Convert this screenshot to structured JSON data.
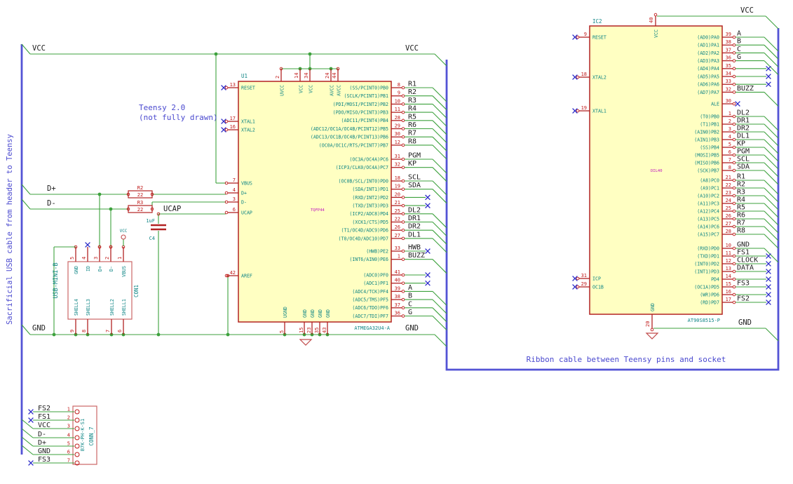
{
  "notes": {
    "usb_cable": "Sacrificial USB cable from header to Teensy",
    "teensy_line1": "Teensy 2.0",
    "teensy_line2": "(not fully drawn)",
    "ribbon": "Ribbon cable between Teensy pins and socket"
  },
  "wire_labels": {
    "vcc_top_left": "VCC",
    "vcc_top_right": "VCC",
    "gnd_bottom_left": "GND",
    "gnd_bottom_right": "GND",
    "dplus": "D+",
    "dminus": "D-",
    "ucap": "UCAP",
    "ic2_vcc": "VCC",
    "ic2_gnd": "GND"
  },
  "u1": {
    "ref": "U1",
    "value": "ATMEGA32U4-A",
    "footprint": "TQFP44",
    "top_pins": [
      {
        "num": "2",
        "name": "UVCC"
      },
      {
        "num": "14",
        "name": "VCC"
      },
      {
        "num": "34",
        "name": "VCC"
      },
      {
        "num": "24",
        "name": "AVCC"
      },
      {
        "num": "44",
        "name": "AVCC"
      }
    ],
    "bottom_pins": [
      {
        "num": "5",
        "name": "UGND"
      },
      {
        "num": "15",
        "name": "GND"
      },
      {
        "num": "23",
        "name": "GND"
      },
      {
        "num": "35",
        "name": "GND"
      },
      {
        "num": "43",
        "name": "GND"
      }
    ],
    "left_pins": [
      {
        "num": "13",
        "name": "RESET",
        "nc": true
      },
      {
        "num": "17",
        "name": "XTAL1",
        "nc": true
      },
      {
        "num": "16",
        "name": "XTAL2",
        "nc": true
      },
      {
        "num": "7",
        "name": "VBUS"
      },
      {
        "num": "4",
        "name": "D+"
      },
      {
        "num": "3",
        "name": "D-"
      },
      {
        "num": "6",
        "name": "UCAP"
      },
      {
        "num": "42",
        "name": "AREF"
      }
    ],
    "right_groups": [
      [
        {
          "num": "8",
          "name": "(SS/PCINT0)PB0",
          "net": "R1",
          "term": "bus"
        },
        {
          "num": "9",
          "name": "(SCLK/PCINT1)PB1",
          "net": "R2",
          "term": "bus"
        },
        {
          "num": "10",
          "name": "(PDI/MOSI/PCINT2)PB2",
          "net": "R3",
          "term": "bus"
        },
        {
          "num": "11",
          "name": "(PDO/MISO/PCINT3)PB3",
          "net": "R4",
          "term": "bus"
        },
        {
          "num": "28",
          "name": "(ADC11/PCINT4)PB4",
          "net": "R5",
          "term": "bus"
        },
        {
          "num": "29",
          "name": "(ADC12/OC1A/OC4B/PCINT12)PB5",
          "net": "R6",
          "term": "bus"
        },
        {
          "num": "30",
          "name": "(ADC13/OC1B/OC4B/PCINT13)PB6",
          "net": "R7",
          "term": "bus"
        },
        {
          "num": "12",
          "name": "(OC0A/OC1C/RTS/PCINT7)PB7",
          "net": "R8",
          "term": "bus"
        }
      ],
      [
        {
          "num": "31",
          "name": "(OC3A/OC4A)PC6",
          "net": "PGM",
          "term": "bus"
        },
        {
          "num": "32",
          "name": "(ICP3/CLK0/OC4A)PC7",
          "net": "KP",
          "term": "bus"
        }
      ],
      [
        {
          "num": "18",
          "name": "(OC0B/SCL/INT0)PD0",
          "net": "SCL",
          "term": "bus"
        },
        {
          "num": "19",
          "name": "(SDA/INT1)PD1",
          "net": "SDA",
          "term": "bus"
        },
        {
          "num": "20",
          "name": "(RXD/INT2)PD2",
          "term": "nc"
        },
        {
          "num": "21",
          "name": "(TXD/INT3)PD3",
          "term": "nc"
        },
        {
          "num": "25",
          "name": "(ICP2/ADC8)PD4",
          "net": "DL2",
          "term": "bus"
        },
        {
          "num": "22",
          "name": "(XCK1/CTS)PD5",
          "net": "DR1",
          "term": "bus"
        },
        {
          "num": "26",
          "name": "(T1/OC4D/ADC9)PD6",
          "net": "DR2",
          "term": "bus"
        },
        {
          "num": "27",
          "name": "(T0/OC4D/ADC10)PD7",
          "net": "DL1",
          "term": "bus"
        }
      ],
      [
        {
          "num": "33",
          "name": "(HWB)PE2",
          "net": "HWB",
          "term": "label_nc"
        },
        {
          "num": "1",
          "name": "(INT6/AIN0)PE6",
          "net": "BUZZ",
          "term": "bus"
        }
      ],
      [
        {
          "num": "41",
          "name": "(ADC0)PF0",
          "term": "nc"
        },
        {
          "num": "40",
          "name": "(ADC1)PF1",
          "term": "nc"
        },
        {
          "num": "39",
          "name": "(ADC4/TCK)PF4",
          "net": "A",
          "term": "bus"
        },
        {
          "num": "38",
          "name": "(ADC5/TMS)PF5",
          "net": "B",
          "term": "bus"
        },
        {
          "num": "37",
          "name": "(ADC6/TDO)PF6",
          "net": "C",
          "term": "bus"
        },
        {
          "num": "36",
          "name": "(ADC7/TDI)PF7",
          "net": "G",
          "term": "bus"
        }
      ]
    ]
  },
  "ic2": {
    "ref": "IC2",
    "value": "AT90S8515-P",
    "footprint": "DIL40",
    "top_pins": [
      {
        "num": "40",
        "name": "VCC"
      }
    ],
    "bottom_pins": [
      {
        "num": "20",
        "name": "GND"
      }
    ],
    "left_pins": [
      {
        "num": "9",
        "name": "RESET",
        "nc": true
      },
      {
        "num": "18",
        "name": "XTAL2",
        "nc": true
      },
      {
        "num": "19",
        "name": "XTAL1",
        "nc": true
      },
      {
        "num": "31",
        "name": "ICP",
        "nc": true
      },
      {
        "num": "29",
        "name": "OC1B",
        "nc": true
      }
    ],
    "right_groups": [
      [
        {
          "num": "39",
          "name": "(AD0)PA0",
          "net": "A",
          "term": "bus"
        },
        {
          "num": "38",
          "name": "(AD1)PA1",
          "net": "B",
          "term": "bus"
        },
        {
          "num": "37",
          "name": "(AD2)PA2",
          "net": "C",
          "term": "bus"
        },
        {
          "num": "36",
          "name": "(AD3)PA3",
          "net": "G",
          "term": "bus"
        },
        {
          "num": "35",
          "name": "(AD4)PA4",
          "term": "nc"
        },
        {
          "num": "34",
          "name": "(AD5)PA5",
          "term": "nc"
        },
        {
          "num": "33",
          "name": "(AD6)PA6",
          "term": "nc"
        },
        {
          "num": "32",
          "name": "(AD7)PA7",
          "net": "BUZZ",
          "term": "bus"
        }
      ],
      [
        {
          "num": "30",
          "name": "ALE",
          "term": "nc_short"
        }
      ],
      [
        {
          "num": "1",
          "name": "(T0)PB0",
          "net": "DL2",
          "term": "bus"
        },
        {
          "num": "2",
          "name": "(T1)PB1",
          "net": "DR1",
          "term": "bus"
        },
        {
          "num": "3",
          "name": "(AIN0)PB2",
          "net": "DR2",
          "term": "bus"
        },
        {
          "num": "4",
          "name": "(AIN1)PB3",
          "net": "DL1",
          "term": "bus"
        },
        {
          "num": "5",
          "name": "(SS)PB4",
          "net": "KP",
          "term": "bus"
        },
        {
          "num": "6",
          "name": "(MOSI)PB5",
          "net": "PGM",
          "term": "bus"
        },
        {
          "num": "7",
          "name": "(MISO)PB6",
          "net": "SCL",
          "term": "bus"
        },
        {
          "num": "8",
          "name": "(SCK)PB7",
          "net": "SDA",
          "term": "bus"
        }
      ],
      [
        {
          "num": "21",
          "name": "(A8)PC0",
          "net": "R1",
          "term": "bus"
        },
        {
          "num": "22",
          "name": "(A9)PC1",
          "net": "R2",
          "term": "bus"
        },
        {
          "num": "23",
          "name": "(A10)PC2",
          "net": "R3",
          "term": "bus"
        },
        {
          "num": "24",
          "name": "(A11)PC3",
          "net": "R4",
          "term": "bus"
        },
        {
          "num": "25",
          "name": "(A12)PC4",
          "net": "R5",
          "term": "bus"
        },
        {
          "num": "26",
          "name": "(A13)PC5",
          "net": "R6",
          "term": "bus"
        },
        {
          "num": "27",
          "name": "(A14)PC6",
          "net": "R7",
          "term": "bus"
        },
        {
          "num": "28",
          "name": "(A15)PC7",
          "net": "R8",
          "term": "bus"
        }
      ],
      [
        {
          "num": "10",
          "name": "(RXD)PD0",
          "net": "GND",
          "term": "bus"
        },
        {
          "num": "11",
          "name": "(TXD)PD1",
          "net": "FS1",
          "term": "label_nc"
        },
        {
          "num": "12",
          "name": "(INT0)PD2",
          "net": "CLOCK",
          "term": "label_nc"
        },
        {
          "num": "13",
          "name": "(INT1)PD3",
          "net": "DATA",
          "term": "label_nc"
        },
        {
          "num": "14",
          "name": "PD4",
          "term": "nc"
        },
        {
          "num": "15",
          "name": "(OC1A)PD5",
          "net": "FS3",
          "term": "label_nc"
        },
        {
          "num": "16",
          "name": "(WR)PD6",
          "term": "nc"
        },
        {
          "num": "17",
          "name": "(RD)PD7",
          "net": "FS2",
          "term": "label_nc"
        }
      ]
    ]
  },
  "con1": {
    "ref": "CON1",
    "value": "USB-MINI-B",
    "vcc_symbol_label": "VCC",
    "top_pins": [
      {
        "num": "5",
        "name": "GND"
      },
      {
        "num": "4",
        "name": "ID",
        "nc": true
      },
      {
        "num": "3",
        "name": "D+"
      },
      {
        "num": "2",
        "name": "D-"
      },
      {
        "num": "1",
        "name": "VBUS"
      }
    ],
    "bottom_pins": [
      {
        "num": "9",
        "name": "SHELL4"
      },
      {
        "num": "8",
        "name": "SHELL3"
      },
      {
        "num": "7",
        "name": "SHELL2"
      },
      {
        "num": "6",
        "name": "SHELL1"
      }
    ]
  },
  "conn7": {
    "ref": "CONN_7",
    "value": "B7K-PH-K-S1",
    "pins": [
      {
        "num": "1",
        "net": "FS2",
        "term": "nc"
      },
      {
        "num": "2",
        "net": "FS1",
        "term": "nc"
      },
      {
        "num": "3",
        "net": "VCC",
        "term": "bus"
      },
      {
        "num": "4",
        "net": "D-",
        "term": "bus"
      },
      {
        "num": "5",
        "net": "D+",
        "term": "bus"
      },
      {
        "num": "6",
        "net": "GND",
        "term": "bus"
      },
      {
        "num": "7",
        "net": "FS3",
        "term": "nc"
      }
    ]
  },
  "r2": {
    "ref": "R2",
    "value": "22"
  },
  "r3": {
    "ref": "R3",
    "value": "22"
  },
  "c4": {
    "ref": "C4",
    "value": "1uF"
  },
  "colors": {
    "wire": "#3da13d",
    "bus": "#5353d5",
    "outline": "#b22222",
    "connector_outline": "#c66",
    "pin_number": "#c01818",
    "pin_name": "#0e8585",
    "footprint": "#c015c0",
    "net_label": "#1c1c1c",
    "no_connect": "#2a2ac8",
    "note": "#4a49cf",
    "symbol_fill": "#ffffc2",
    "power_symbol": "#c04a4a"
  }
}
